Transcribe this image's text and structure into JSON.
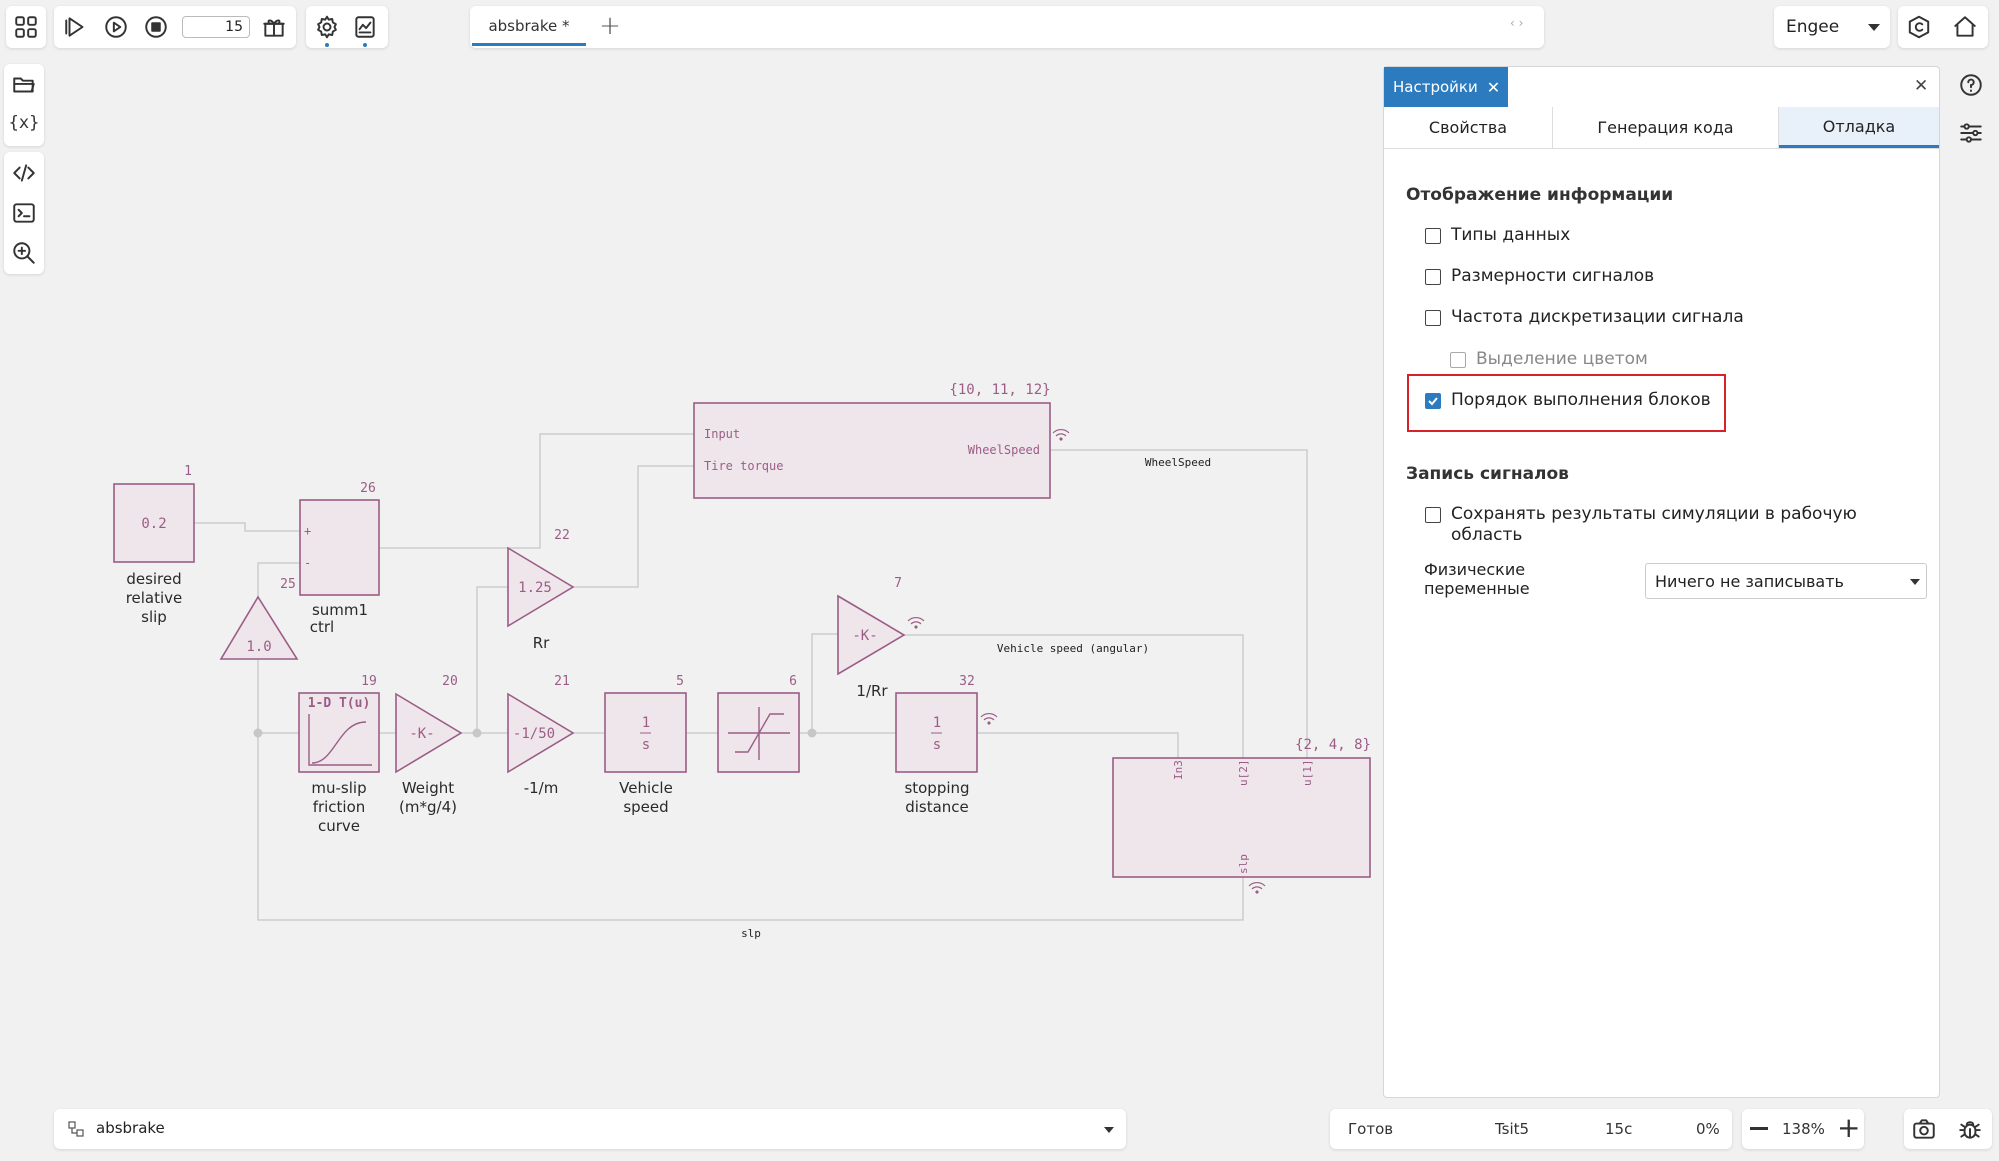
{
  "toolbar": {
    "step_value": "15",
    "tab_title": "absbrake *",
    "workspace": "Engee"
  },
  "settings": {
    "panel_tab": "Настройки",
    "tabs": [
      "Свойства",
      "Генерация кода",
      "Отладка"
    ],
    "section_display": "Отображение информации",
    "opt_types": "Типы данных",
    "opt_dims": "Размерности сигналов",
    "opt_rate": "Частота дискретизации сигнала",
    "opt_color": "Выделение цветом",
    "opt_order": "Порядок выполнения блоков",
    "section_record": "Запись сигналов",
    "opt_save_line1": "Сохранять результаты симуляции в рабочую",
    "opt_save_line2": "область",
    "phys_label_line1": "Физические",
    "phys_label_line2": "переменные",
    "phys_select": "Ничего не записывать"
  },
  "diagram": {
    "b_desired_val": "0.2",
    "b_desired_num": "1",
    "b_desired_l1": "desired",
    "b_desired_l2": "relative",
    "b_desired_l3": "slip",
    "b_summ_num": "26",
    "b_summ_plus": "+",
    "b_summ_minus": "-",
    "b_summ_l1": "summ1",
    "b_summ_l2": "ctrl",
    "b_const_val": "1.0",
    "b_const_num": "25",
    "b_rr_val": "1.25",
    "b_rr_num": "22",
    "b_rr_label": "Rr",
    "b_wheel_num": "{10, 11, 12}",
    "b_wheel_in1": "Input",
    "b_wheel_in2": "Tire torque",
    "b_wheel_out": "WheelSpeed",
    "sig_wheelspeed": "WheelSpeed",
    "b_mu_title": "1-D T(u)",
    "b_mu_num": "19",
    "b_mu_l1": "mu-slip",
    "b_mu_l2": "friction",
    "b_mu_l3": "curve",
    "b_weight_val": "-K-",
    "b_weight_num": "20",
    "b_weight_l1": "Weight",
    "b_weight_l2": "(m*g/4)",
    "b_m_val": "-1/50",
    "b_m_num": "21",
    "b_m_label": "-1/m",
    "b_vs_num": "5",
    "b_vs_top": "1",
    "b_vs_bot": "s",
    "b_vs_l1": "Vehicle",
    "b_vs_l2": "speed",
    "b_sat_num": "6",
    "b_rr2_val": "-K-",
    "b_rr2_num": "7",
    "b_rr2_label": "1/Rr",
    "sig_vehicle": "Vehicle speed (angular)",
    "b_sd_num": "32",
    "b_sd_top": "1",
    "b_sd_bot": "s",
    "b_sd_l1": "stopping",
    "b_sd_l2": "distance",
    "b_sub_num": "{2, 4, 8}",
    "b_sub_p1": "In3",
    "b_sub_p2": "u[2]",
    "b_sub_p3": "u[1]",
    "b_sub_p4": "slp",
    "sig_slp": "slp"
  },
  "footer": {
    "model_name": "absbrake",
    "status": "Готов",
    "solver": "Tsit5",
    "time": "15с",
    "progress": "0%",
    "zoom": "138%"
  },
  "colors": {
    "accent": "#2c7bbf",
    "block_stroke": "#9b5d86",
    "block_fill": "#efe6ec",
    "highlight": "#d9212a"
  }
}
